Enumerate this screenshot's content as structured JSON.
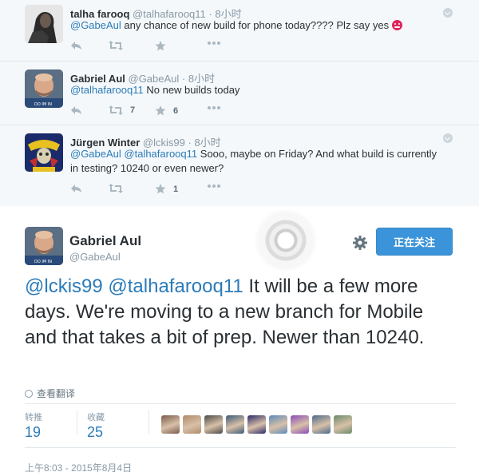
{
  "replies": [
    {
      "name": "talha farooq",
      "handle": "@talhafarooq11",
      "time": "8小时",
      "text_mention": "@GabeAul",
      "text": " any chance of new build for phone today???? Plz say yes ",
      "emoji": "angry-face-emoji",
      "retweets": "",
      "favorites": ""
    },
    {
      "name": "Gabriel Aul",
      "handle": "@GabeAul",
      "time": "8小时",
      "text_mention": "@talhafarooq11",
      "text": " No new builds today",
      "retweets": "7",
      "favorites": "6"
    },
    {
      "name": "Jürgen Winter",
      "handle": "@lckis99",
      "time": "8小时",
      "text_mention": "@GabeAul @talhafarooq11",
      "text": " Sooo, maybe on Friday? And what build is currently in testing? 10240 or even newer?",
      "retweets": "",
      "favorites": "1"
    }
  ],
  "separator": "·",
  "main": {
    "name": "Gabriel Aul",
    "handle": "@GabeAul",
    "follow_label": "正在关注",
    "text_mentions": "@lckis99 @talhafarooq11",
    "text": " It will be a few more days. We're moving to a new branch for Mobile and that takes a bit of prep. Newer than 10240.",
    "translate_label": "查看翻译",
    "retweets_label": "转推",
    "retweets": "19",
    "favorites_label": "收藏",
    "favorites": "25",
    "timestamp": "上午8:03 - 2015年8月4日"
  },
  "colors": {
    "link": "#2b7bb9",
    "follow_button": "#3b94d9",
    "reply_bg": "#f5f8fa",
    "face_colors": [
      "#7a5a4a",
      "#b08a6a",
      "#4a4a4a",
      "#3a5a7a",
      "#2a2a6a",
      "#5a8aba",
      "#8a4aba",
      "#4a6a8a",
      "#6a8a6a"
    ]
  }
}
